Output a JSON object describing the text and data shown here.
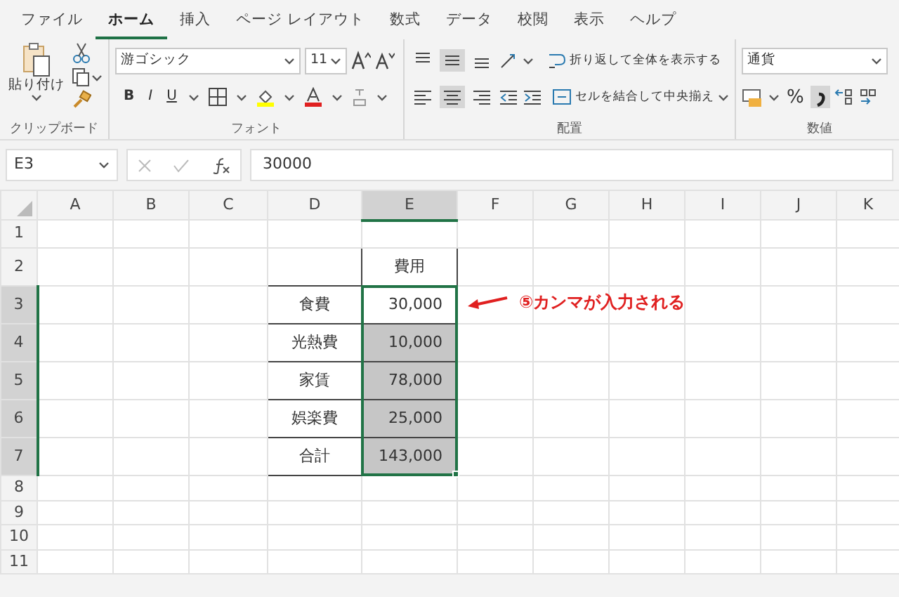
{
  "ribbon_tabs": [
    {
      "label": "ファイル",
      "selected": false
    },
    {
      "label": "ホーム",
      "selected": true
    },
    {
      "label": "挿入",
      "selected": false
    },
    {
      "label": "ページ レイアウト",
      "selected": false
    },
    {
      "label": "数式",
      "selected": false
    },
    {
      "label": "データ",
      "selected": false
    },
    {
      "label": "校閲",
      "selected": false
    },
    {
      "label": "表示",
      "selected": false
    },
    {
      "label": "ヘルプ",
      "selected": false
    }
  ],
  "clipboard": {
    "paste_label": "貼り付け",
    "group_label": "クリップボード"
  },
  "font": {
    "font_name": "游ゴシック",
    "font_size": "11",
    "bold": "B",
    "italic": "I",
    "underline": "U",
    "group_label": "フォント"
  },
  "alignment": {
    "vertical_align": [
      {
        "kind": "top",
        "selected": false
      },
      {
        "kind": "middle",
        "selected": true
      },
      {
        "kind": "bottom",
        "selected": false
      }
    ],
    "horizontal_align": [
      {
        "kind": "left",
        "selected": false
      },
      {
        "kind": "center",
        "selected": true
      },
      {
        "kind": "right",
        "selected": false
      }
    ],
    "wrap_text": "折り返して全体を表示する",
    "merge_center": "セルを結合して中央揃え",
    "group_label": "配置"
  },
  "number": {
    "format": "通貨",
    "percent": "%",
    "comma_selected": true,
    "group_label": "数値"
  },
  "formula_bar": {
    "name_box": "E3",
    "formula": "30000"
  },
  "columns": [
    {
      "label": "A",
      "selected": false
    },
    {
      "label": "B",
      "selected": false
    },
    {
      "label": "C",
      "selected": false
    },
    {
      "label": "D",
      "selected": false
    },
    {
      "label": "E",
      "selected": true
    },
    {
      "label": "F",
      "selected": false
    },
    {
      "label": "G",
      "selected": false
    },
    {
      "label": "H",
      "selected": false
    },
    {
      "label": "I",
      "selected": false
    },
    {
      "label": "J",
      "selected": false
    },
    {
      "label": "K",
      "selected": false
    }
  ],
  "rows": [
    {
      "number": "1",
      "selected": false
    },
    {
      "number": "2",
      "selected": false
    },
    {
      "number": "3",
      "selected": true
    },
    {
      "number": "4",
      "selected": true
    },
    {
      "number": "5",
      "selected": true
    },
    {
      "number": "6",
      "selected": true
    },
    {
      "number": "7",
      "selected": true
    },
    {
      "number": "8",
      "selected": false
    },
    {
      "number": "9",
      "selected": false
    },
    {
      "number": "10",
      "selected": false
    },
    {
      "number": "11",
      "selected": false
    }
  ],
  "expense_table": {
    "header": "費用",
    "rows": [
      {
        "label": "食費",
        "amount": "30,000",
        "highlighted": false,
        "active": true
      },
      {
        "label": "光熱費",
        "amount": "10,000",
        "highlighted": true,
        "active": false
      },
      {
        "label": "家賃",
        "amount": "78,000",
        "highlighted": true,
        "active": false
      },
      {
        "label": "娯楽費",
        "amount": "25,000",
        "highlighted": true,
        "active": false
      },
      {
        "label": "合計",
        "amount": "143,000",
        "highlighted": true,
        "active": false
      }
    ]
  },
  "annotation": {
    "text": "⑤カンマが入力される"
  }
}
